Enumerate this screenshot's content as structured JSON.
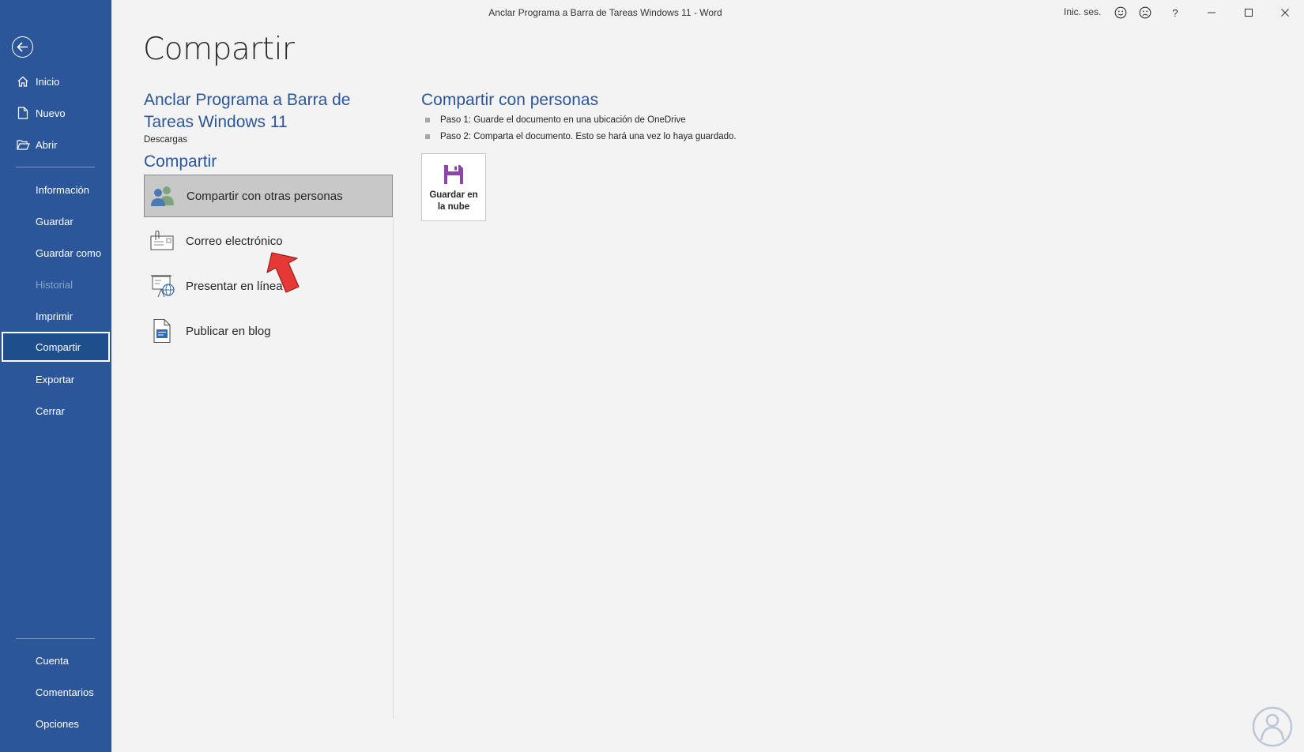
{
  "window": {
    "title": "Anclar Programa a Barra de Tareas Windows 11  -  Word",
    "signin": "Inic. ses.",
    "icons": [
      "smile-icon",
      "frown-icon",
      "help-icon",
      "minimize-icon",
      "maximize-icon",
      "close-icon"
    ],
    "help_glyph": "?"
  },
  "sidebar": {
    "back_icon": "back-arrow-icon",
    "top_items": [
      {
        "label": "Inicio",
        "icon": "home-icon"
      },
      {
        "label": "Nuevo",
        "icon": "new-document-icon"
      },
      {
        "label": "Abrir",
        "icon": "open-folder-icon"
      }
    ],
    "items": [
      {
        "label": "Información"
      },
      {
        "label": "Guardar"
      },
      {
        "label": "Guardar como"
      },
      {
        "label": "Historial",
        "disabled": true
      },
      {
        "label": "Imprimir"
      },
      {
        "label": "Compartir",
        "selected": true
      },
      {
        "label": "Exportar"
      },
      {
        "label": "Cerrar"
      }
    ],
    "bottom_items": [
      {
        "label": "Cuenta"
      },
      {
        "label": "Comentarios"
      },
      {
        "label": "Opciones"
      }
    ]
  },
  "main": {
    "page_title": "Compartir",
    "document_name": "Anclar Programa a Barra de Tareas Windows 11",
    "document_location": "Descargas",
    "share_heading": "Compartir",
    "share_options": [
      {
        "label": "Compartir con otras personas",
        "icon": "share-people-icon",
        "active": true
      },
      {
        "label": "Correo electrónico",
        "icon": "email-icon"
      },
      {
        "label": "Presentar en línea",
        "icon": "present-online-icon"
      },
      {
        "label": "Publicar en blog",
        "icon": "blog-icon"
      }
    ],
    "people_heading": "Compartir con personas",
    "steps": [
      "Paso 1: Guarde el documento en una ubicación de OneDrive",
      "Paso 2: Comparta el documento. Esto se hará una vez lo haya guardado."
    ],
    "cloud_button": {
      "line1": "Guardar en",
      "line2": "la nube",
      "icon": "save-floppy-icon"
    }
  },
  "colors": {
    "sidebar": "#2b579a",
    "accent_text": "#2b579a",
    "background": "#f3f3f3",
    "annotation_arrow": "#e53935",
    "floppy": "#8e44ad"
  }
}
